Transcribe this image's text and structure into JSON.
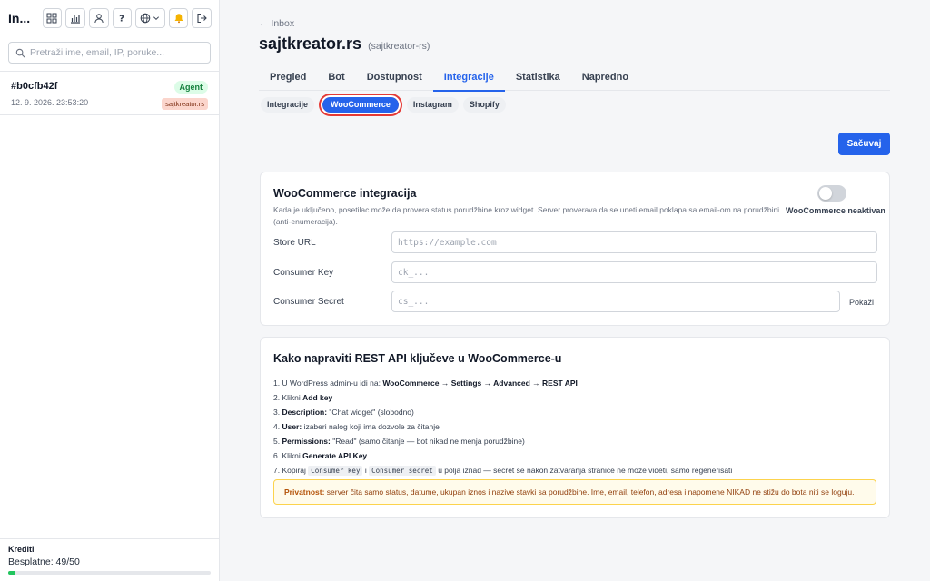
{
  "sidebar": {
    "title": "In...",
    "search_placeholder": "Pretraži ime, email, IP, poruke...",
    "language_icon": "globe-icon",
    "conversations": [
      {
        "id": "#b0cfb42f",
        "time": "12. 9. 2026. 23:53:20",
        "badge": "Agent",
        "site": "sajtkreator.rs"
      }
    ],
    "credits": {
      "label": "Krediti",
      "value": "Besplatne: 49/50",
      "used": 49,
      "total": 50
    }
  },
  "header": {
    "back": "← Inbox",
    "title": "sajtkreator.rs",
    "slug": "(sajtkreator-rs)"
  },
  "tabs": [
    "Pregled",
    "Bot",
    "Dostupnost",
    "Integracije",
    "Statistika",
    "Napredno"
  ],
  "active_tab": "Integracije",
  "subtabs": [
    "Integracije",
    "WooCommerce",
    "Instagram",
    "Shopify"
  ],
  "active_subtab": "WooCommerce",
  "save_label": "Sačuvaj",
  "woo": {
    "title": "WooCommerce integracija",
    "description": "Kada je uključeno, posetilac može da provera status porudžbine kroz widget. Server proverava da se uneti email poklapa sa email-om na porudžbini (anti-enumeracija).",
    "toggle_label": "WooCommerce neaktivan",
    "toggle_on": false,
    "store_url_label": "Store URL",
    "store_url_placeholder": "https://example.com",
    "consumer_key_label": "Consumer Key",
    "consumer_key_placeholder": "ck_...",
    "consumer_secret_label": "Consumer Secret",
    "consumer_secret_placeholder": "cs_...",
    "show_label": "Pokaži"
  },
  "guide": {
    "title": "Kako napraviti REST API ključeve u WooCommerce-u",
    "steps": {
      "s1_a": "1. U WordPress admin-u idi na: ",
      "s1_b": "WooCommerce → Settings → Advanced → REST API",
      "s2_a": "2. Klikni ",
      "s2_b": "Add key",
      "s3_a": "3. ",
      "s3_b": "Description:",
      "s3_c": " \"Chat widget\" (slobodno)",
      "s4_a": "4. ",
      "s4_b": "User:",
      "s4_c": " izaberi nalog koji ima dozvole za čitanje",
      "s5_a": "5. ",
      "s5_b": "Permissions:",
      "s5_c": " \"Read\" (samo čitanje — bot nikad ne menja porudžbine)",
      "s6_a": "6. Klikni ",
      "s6_b": "Generate API Key",
      "s7_a": "7. Kopiraj ",
      "s7_code1": "Consumer key",
      "s7_mid": " i ",
      "s7_code2": "Consumer secret",
      "s7_c": " u polja iznad — secret se nakon zatvaranja stranice ne može videti, samo regenerisati"
    },
    "privacy_label": "Privatnost:",
    "privacy_text": " server čita samo status, datume, ukupan iznos i nazive stavki sa porudžbine. Ime, email, telefon, adresa i napomene NIKAD ne stižu do bota niti se loguju."
  },
  "colors": {
    "accent": "#2563eb",
    "highlight": "#e53935"
  }
}
